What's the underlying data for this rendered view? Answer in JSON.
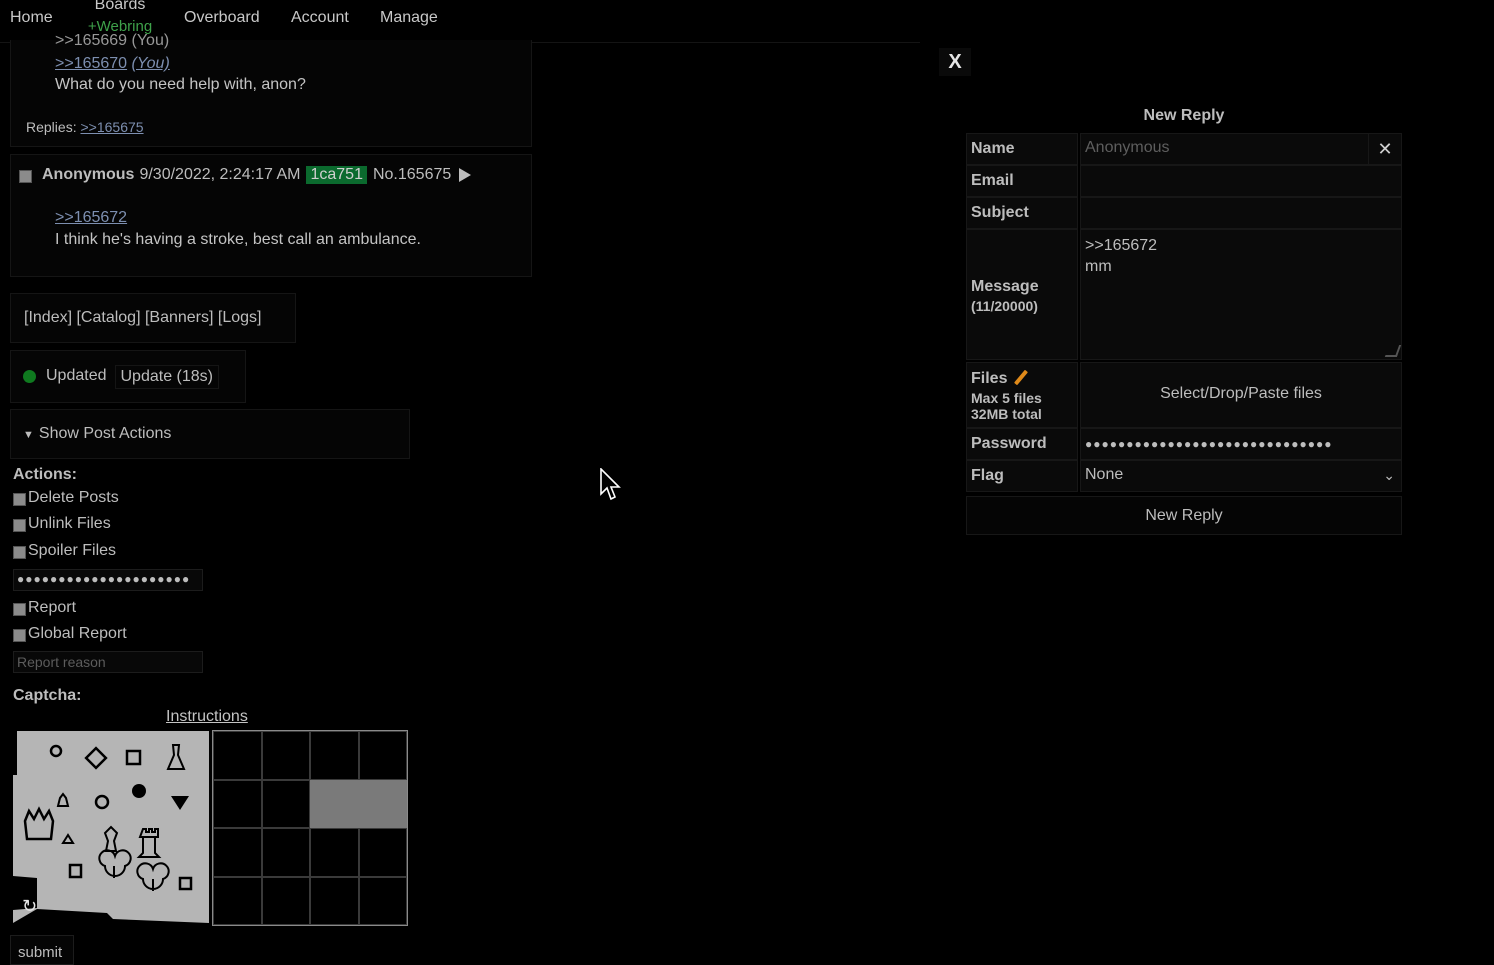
{
  "nav": {
    "home": "Home",
    "boards": "Boards",
    "webring": "+Webring",
    "overboard": "Overboard",
    "account": "Account",
    "manage": "Manage"
  },
  "post_a": {
    "quote_partial": ">>165669 (You)",
    "quote": ">>165670",
    "you": "(You)",
    "body": "What do you need help with, anon?",
    "replies_label": "Replies:",
    "replies_link": ">>165675"
  },
  "post_b": {
    "name": "Anonymous",
    "date": "9/30/2022, 2:24:17 AM",
    "id": "1ca751",
    "number": "No.165675",
    "quote": ">>165672",
    "body": "I think he's having a stroke, best call an ambulance."
  },
  "board_links": "[Index] [Catalog] [Banners] [Logs]",
  "updater": {
    "status": "Updated",
    "button": "Update (18s)",
    "dot_color": "#0f7a1f"
  },
  "post_actions": {
    "toggle": "Show Post Actions",
    "actions_label": "Actions:",
    "delete_posts": "Delete Posts",
    "unlink_files": "Unlink Files",
    "spoiler_files": "Spoiler Files",
    "password_dots": "●●●●●●●●●●●●●●●●●●●●●",
    "report": "Report",
    "global_report": "Global Report",
    "report_reason_placeholder": "Report reason"
  },
  "captcha": {
    "label": "Captcha:",
    "instructions": "Instructions",
    "refresh": "↻",
    "submit": "submit"
  },
  "reply_form": {
    "close": "X",
    "title": "New Reply",
    "name_label": "Name",
    "name_placeholder": "Anonymous",
    "email_label": "Email",
    "subject_label": "Subject",
    "message_label": "Message",
    "message_count": "(11/20000)",
    "message_line1": ">>165672",
    "message_line2": "mm",
    "files_label": "Files",
    "files_max": "Max 5 files",
    "files_total": "32MB total",
    "files_drop": "Select/Drop/Paste files",
    "password_label": "Password",
    "password_dots": "●●●●●●●●●●●●●●●●●●●●●●●●●●●●●●",
    "flag_label": "Flag",
    "flag_value": "None",
    "submit": "New Reply",
    "clear": "✕"
  },
  "colors": {
    "webring": "#3ea14a",
    "id_badge": "#0b6a2e",
    "link": "#7d8fb0"
  }
}
